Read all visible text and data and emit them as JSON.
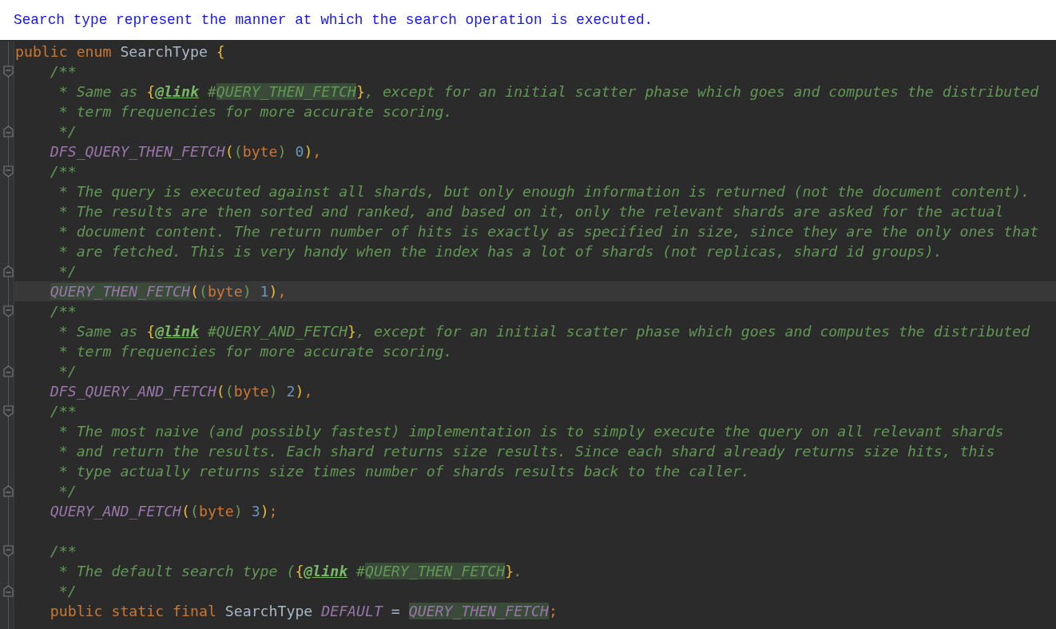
{
  "caption": "Search type represent the manner at which the search operation is executed.",
  "editor": {
    "lines": [
      {
        "fold_start": false,
        "fold_end": false,
        "current": false,
        "segments": [
          {
            "kind": "keyword",
            "text": "public enum "
          },
          {
            "kind": "plain",
            "text": "SearchType "
          },
          {
            "kind": "bracket",
            "text": "{"
          }
        ],
        "children": [
          {
            "fold_start": true,
            "fold_end": false,
            "current": false,
            "segments": [
              {
                "kind": "comment",
                "text": "/**"
              }
            ]
          },
          {
            "fold_start": false,
            "fold_end": false,
            "current": false,
            "segments": [
              {
                "kind": "comment",
                "text": " * Same as "
              },
              {
                "kind": "bracket",
                "text": "{"
              },
              {
                "kind": "doctag",
                "text": "@link"
              },
              {
                "kind": "comment",
                "text": " #"
              },
              {
                "kind": "ref",
                "marked": true,
                "text": "QUERY_THEN_FETCH"
              },
              {
                "kind": "bracket",
                "text": "}"
              },
              {
                "kind": "comment",
                "text": ", except for an initial scatter phase which goes and computes the distributed"
              }
            ]
          },
          {
            "fold_start": false,
            "fold_end": false,
            "current": false,
            "segments": [
              {
                "kind": "comment",
                "text": " * term frequencies for more accurate scoring."
              }
            ]
          },
          {
            "fold_start": false,
            "fold_end": true,
            "current": false,
            "segments": [
              {
                "kind": "comment",
                "text": " */"
              }
            ]
          },
          {
            "fold_start": false,
            "fold_end": false,
            "current": false,
            "segments": [
              {
                "kind": "constant",
                "marked": false,
                "text": "DFS_QUERY_THEN_FETCH"
              },
              {
                "kind": "bracket",
                "text": "("
              },
              {
                "kind": "bracket2",
                "text": "("
              },
              {
                "kind": "keyword",
                "text": "byte"
              },
              {
                "kind": "bracket2",
                "text": ")"
              },
              {
                "kind": "number",
                "text": " 0"
              },
              {
                "kind": "bracket",
                "text": ")"
              },
              {
                "kind": "punct",
                "text": ","
              }
            ]
          },
          {
            "fold_start": true,
            "fold_end": false,
            "current": false,
            "segments": [
              {
                "kind": "comment",
                "text": "/**"
              }
            ]
          },
          {
            "fold_start": false,
            "fold_end": false,
            "current": false,
            "segments": [
              {
                "kind": "comment",
                "text": " * The query is executed against all shards, but only enough information is returned (not the document content)."
              }
            ]
          },
          {
            "fold_start": false,
            "fold_end": false,
            "current": false,
            "segments": [
              {
                "kind": "comment",
                "text": " * The results are then sorted and ranked, and based on it, only the relevant shards are asked for the actual"
              }
            ]
          },
          {
            "fold_start": false,
            "fold_end": false,
            "current": false,
            "segments": [
              {
                "kind": "comment",
                "text": " * document content. The return number of hits is exactly as specified in size, since they are the only ones that"
              }
            ]
          },
          {
            "fold_start": false,
            "fold_end": false,
            "current": false,
            "segments": [
              {
                "kind": "comment",
                "text": " * are fetched. This is very handy when the index has a lot of shards (not replicas, shard id groups)."
              }
            ]
          },
          {
            "fold_start": false,
            "fold_end": true,
            "current": false,
            "segments": [
              {
                "kind": "comment",
                "text": " */"
              }
            ]
          },
          {
            "fold_start": false,
            "fold_end": false,
            "current": true,
            "segments": [
              {
                "kind": "constant",
                "marked": true,
                "text": "QUERY_THEN_FETCH"
              },
              {
                "kind": "bracket",
                "text": "("
              },
              {
                "kind": "bracket2",
                "text": "("
              },
              {
                "kind": "keyword",
                "text": "byte"
              },
              {
                "kind": "bracket2",
                "text": ")"
              },
              {
                "kind": "number",
                "text": " 1"
              },
              {
                "kind": "bracket",
                "text": ")"
              },
              {
                "kind": "punct",
                "text": ","
              }
            ]
          },
          {
            "fold_start": true,
            "fold_end": false,
            "current": false,
            "segments": [
              {
                "kind": "comment",
                "text": "/**"
              }
            ]
          },
          {
            "fold_start": false,
            "fold_end": false,
            "current": false,
            "segments": [
              {
                "kind": "comment",
                "text": " * Same as "
              },
              {
                "kind": "bracket",
                "text": "{"
              },
              {
                "kind": "doctag",
                "text": "@link"
              },
              {
                "kind": "comment",
                "text": " #"
              },
              {
                "kind": "ref",
                "marked": false,
                "text": "QUERY_AND_FETCH"
              },
              {
                "kind": "bracket",
                "text": "}"
              },
              {
                "kind": "comment",
                "text": ", except for an initial scatter phase which goes and computes the distributed"
              }
            ]
          },
          {
            "fold_start": false,
            "fold_end": false,
            "current": false,
            "segments": [
              {
                "kind": "comment",
                "text": " * term frequencies for more accurate scoring."
              }
            ]
          },
          {
            "fold_start": false,
            "fold_end": true,
            "current": false,
            "segments": [
              {
                "kind": "comment",
                "text": " */"
              }
            ]
          },
          {
            "fold_start": false,
            "fold_end": false,
            "current": false,
            "segments": [
              {
                "kind": "constant",
                "marked": false,
                "text": "DFS_QUERY_AND_FETCH"
              },
              {
                "kind": "bracket",
                "text": "("
              },
              {
                "kind": "bracket2",
                "text": "("
              },
              {
                "kind": "keyword",
                "text": "byte"
              },
              {
                "kind": "bracket2",
                "text": ")"
              },
              {
                "kind": "number",
                "text": " 2"
              },
              {
                "kind": "bracket",
                "text": ")"
              },
              {
                "kind": "punct",
                "text": ","
              }
            ]
          },
          {
            "fold_start": true,
            "fold_end": false,
            "current": false,
            "segments": [
              {
                "kind": "comment",
                "text": "/**"
              }
            ]
          },
          {
            "fold_start": false,
            "fold_end": false,
            "current": false,
            "segments": [
              {
                "kind": "comment",
                "text": " * The most naive (and possibly fastest) implementation is to simply execute the query on all relevant shards"
              }
            ]
          },
          {
            "fold_start": false,
            "fold_end": false,
            "current": false,
            "segments": [
              {
                "kind": "comment",
                "text": " * and return the results. Each shard returns size results. Since each shard already returns size hits, this"
              }
            ]
          },
          {
            "fold_start": false,
            "fold_end": false,
            "current": false,
            "segments": [
              {
                "kind": "comment",
                "text": " * type actually returns size times number of shards results back to the caller."
              }
            ]
          },
          {
            "fold_start": false,
            "fold_end": true,
            "current": false,
            "segments": [
              {
                "kind": "comment",
                "text": " */"
              }
            ]
          },
          {
            "fold_start": false,
            "fold_end": false,
            "current": false,
            "segments": [
              {
                "kind": "constant",
                "marked": false,
                "text": "QUERY_AND_FETCH"
              },
              {
                "kind": "bracket",
                "text": "("
              },
              {
                "kind": "bracket2",
                "text": "("
              },
              {
                "kind": "keyword",
                "text": "byte"
              },
              {
                "kind": "bracket2",
                "text": ")"
              },
              {
                "kind": "number",
                "text": " 3"
              },
              {
                "kind": "bracket",
                "text": ")"
              },
              {
                "kind": "punct",
                "text": ";"
              }
            ]
          },
          {
            "fold_start": false,
            "fold_end": false,
            "current": false
          },
          {
            "fold_start": true,
            "fold_end": false,
            "current": false,
            "segments": [
              {
                "kind": "comment",
                "text": "/**"
              }
            ]
          },
          {
            "fold_start": false,
            "fold_end": false,
            "current": false,
            "segments": [
              {
                "kind": "comment",
                "text": " * The default search type ("
              },
              {
                "kind": "bracket",
                "text": "{"
              },
              {
                "kind": "doctag",
                "text": "@link"
              },
              {
                "kind": "comment",
                "text": " #"
              },
              {
                "kind": "ref",
                "marked": true,
                "text": "QUERY_THEN_FETCH"
              },
              {
                "kind": "bracket",
                "text": "}"
              },
              {
                "kind": "comment",
                "text": "."
              }
            ]
          },
          {
            "fold_start": false,
            "fold_end": true,
            "current": false,
            "segments": [
              {
                "kind": "comment",
                "text": " */"
              }
            ]
          },
          {
            "fold_start": false,
            "fold_end": false,
            "current": false,
            "segments": [
              {
                "kind": "keyword",
                "text": "public static final "
              },
              {
                "kind": "plain",
                "text": "SearchType "
              },
              {
                "kind": "constant",
                "marked": false,
                "text": "DEFAULT"
              },
              {
                "kind": "plain",
                "text": " = "
              },
              {
                "kind": "constant",
                "marked": true,
                "text": "QUERY_THEN_FETCH"
              },
              {
                "kind": "punct",
                "text": ";"
              }
            ]
          }
        ]
      }
    ]
  }
}
